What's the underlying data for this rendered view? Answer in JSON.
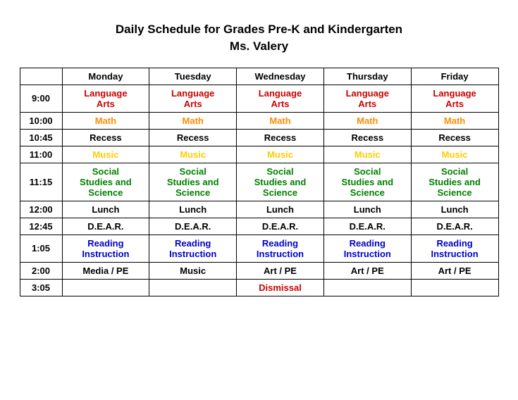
{
  "title": {
    "line1": "Daily Schedule for Grades Pre-K and Kindergarten",
    "line2": "Ms. Valery"
  },
  "columns": [
    "",
    "Monday",
    "Tuesday",
    "Wednesday",
    "Thursday",
    "Friday"
  ],
  "rows": [
    {
      "time": "9:00",
      "cells": [
        {
          "text": "Language Arts",
          "type": "lang-arts"
        },
        {
          "text": "Language Arts",
          "type": "lang-arts"
        },
        {
          "text": "Language Arts",
          "type": "lang-arts"
        },
        {
          "text": "Language Arts",
          "type": "lang-arts"
        },
        {
          "text": "Language Arts",
          "type": "lang-arts"
        }
      ]
    },
    {
      "time": "10:00",
      "cells": [
        {
          "text": "Math",
          "type": "math"
        },
        {
          "text": "Math",
          "type": "math"
        },
        {
          "text": "Math",
          "type": "math"
        },
        {
          "text": "Math",
          "type": "math"
        },
        {
          "text": "Math",
          "type": "math"
        }
      ]
    },
    {
      "time": "10:45",
      "cells": [
        {
          "text": "Recess",
          "type": "normal"
        },
        {
          "text": "Recess",
          "type": "normal"
        },
        {
          "text": "Recess",
          "type": "normal"
        },
        {
          "text": "Recess",
          "type": "normal"
        },
        {
          "text": "Recess",
          "type": "normal"
        }
      ]
    },
    {
      "time": "11:00",
      "cells": [
        {
          "text": "Music",
          "type": "music"
        },
        {
          "text": "Music",
          "type": "music"
        },
        {
          "text": "Music",
          "type": "music"
        },
        {
          "text": "Music",
          "type": "music"
        },
        {
          "text": "Music",
          "type": "music"
        }
      ]
    },
    {
      "time": "11:15",
      "cells": [
        {
          "text": "Social Studies and Science",
          "type": "social"
        },
        {
          "text": "Social Studies and Science",
          "type": "social"
        },
        {
          "text": "Social Studies and Science",
          "type": "social"
        },
        {
          "text": "Social Studies and Science",
          "type": "social"
        },
        {
          "text": "Social Studies and Science",
          "type": "social"
        }
      ]
    },
    {
      "time": "12:00",
      "cells": [
        {
          "text": "Lunch",
          "type": "normal"
        },
        {
          "text": "Lunch",
          "type": "normal"
        },
        {
          "text": "Lunch",
          "type": "normal"
        },
        {
          "text": "Lunch",
          "type": "normal"
        },
        {
          "text": "Lunch",
          "type": "normal"
        }
      ]
    },
    {
      "time": "12:45",
      "cells": [
        {
          "text": "D.E.A.R.",
          "type": "normal"
        },
        {
          "text": "D.E.A.R.",
          "type": "normal"
        },
        {
          "text": "D.E.A.R.",
          "type": "normal"
        },
        {
          "text": "D.E.A.R.",
          "type": "normal"
        },
        {
          "text": "D.E.A.R.",
          "type": "normal"
        }
      ]
    },
    {
      "time": "1:05",
      "cells": [
        {
          "text": "Reading Instruction",
          "type": "reading"
        },
        {
          "text": "Reading Instruction",
          "type": "reading"
        },
        {
          "text": "Reading Instruction",
          "type": "reading"
        },
        {
          "text": "Reading Instruction",
          "type": "reading"
        },
        {
          "text": "Reading Instruction",
          "type": "reading"
        }
      ]
    },
    {
      "time": "2:00",
      "cells": [
        {
          "text": "Media / PE",
          "type": "normal"
        },
        {
          "text": "Music",
          "type": "normal"
        },
        {
          "text": "Art / PE",
          "type": "normal"
        },
        {
          "text": "Art / PE",
          "type": "normal"
        },
        {
          "text": "Art / PE",
          "type": "normal"
        }
      ]
    },
    {
      "time": "3:05",
      "cells": [
        {
          "text": "",
          "type": "normal"
        },
        {
          "text": "",
          "type": "normal"
        },
        {
          "text": "Dismissal",
          "type": "dismissal"
        },
        {
          "text": "",
          "type": "normal"
        },
        {
          "text": "",
          "type": "normal"
        }
      ]
    }
  ]
}
